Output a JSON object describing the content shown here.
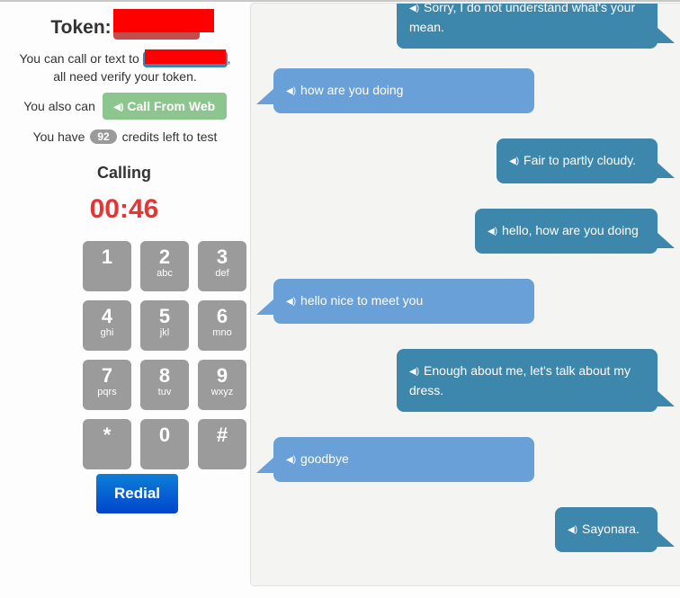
{
  "header": {
    "token_label": "Token:",
    "call_text_before": "You can call or text to",
    "call_text_after": ",",
    "call_text_line2": "all need verify your token.",
    "also_can": "You also can",
    "call_from_web": "Call From Web",
    "credits_before": "You have",
    "credits_value": "92",
    "credits_after": "credits left to test"
  },
  "call": {
    "status": "Calling",
    "timer": "00:46"
  },
  "keypad": [
    {
      "num": "1",
      "letters": ""
    },
    {
      "num": "2",
      "letters": "abc"
    },
    {
      "num": "3",
      "letters": "def"
    },
    {
      "num": "4",
      "letters": "ghi"
    },
    {
      "num": "5",
      "letters": "jkl"
    },
    {
      "num": "6",
      "letters": "mno"
    },
    {
      "num": "7",
      "letters": "pqrs"
    },
    {
      "num": "8",
      "letters": "tuv"
    },
    {
      "num": "9",
      "letters": "wxyz"
    },
    {
      "num": "*",
      "letters": ""
    },
    {
      "num": "0",
      "letters": ""
    },
    {
      "num": "#",
      "letters": ""
    }
  ],
  "redial_label": "Redial",
  "speaker_glyph": "◀)",
  "messages": [
    {
      "sender": "bot",
      "text": "Sorry, I do not understand what's your mean."
    },
    {
      "sender": "user",
      "text": "how are you doing"
    },
    {
      "sender": "bot",
      "text": "Fair to partly cloudy."
    },
    {
      "sender": "bot",
      "text": "hello, how are you doing"
    },
    {
      "sender": "user",
      "text": "hello nice to meet you"
    },
    {
      "sender": "bot",
      "text": "Enough about me, let's talk about my dress."
    },
    {
      "sender": "user",
      "text": "goodbye"
    },
    {
      "sender": "bot",
      "text": "Sayonara."
    }
  ],
  "colors": {
    "user_bubble": "#6aa0d8",
    "bot_bubble": "#3d87ad",
    "timer": "#e53535",
    "call_from_web": "#8cc58d",
    "redial": "#0066cc"
  }
}
